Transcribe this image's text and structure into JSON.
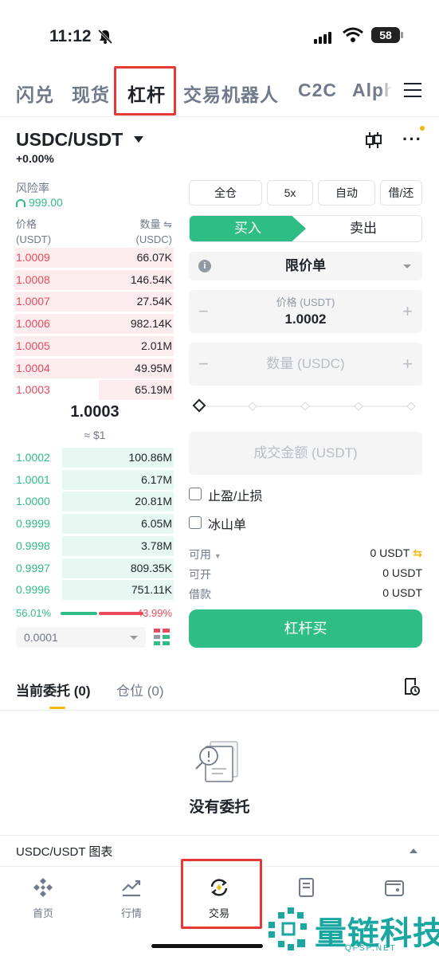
{
  "status_bar": {
    "time": "11:12",
    "battery": "58"
  },
  "top_tabs": [
    {
      "label": "闪兑"
    },
    {
      "label": "现货"
    },
    {
      "label": "杠杆",
      "active": true
    },
    {
      "label": "交易机器人"
    },
    {
      "label": "C2C"
    },
    {
      "label": "Alph"
    }
  ],
  "pair": {
    "name": "USDC/USDT",
    "change": "+0.00%"
  },
  "risk": {
    "label": "风险率",
    "value": "999.00"
  },
  "order_book": {
    "price_header": "价格",
    "price_unit": "(USDT)",
    "qty_header": "数量 ⇋",
    "qty_unit": "(USDC)",
    "asks": [
      {
        "price": "1.0009",
        "qty": "66.07K",
        "depth": 1.0
      },
      {
        "price": "1.0008",
        "qty": "146.54K",
        "depth": 1.0
      },
      {
        "price": "1.0007",
        "qty": "27.54K",
        "depth": 1.0
      },
      {
        "price": "1.0006",
        "qty": "982.14K",
        "depth": 1.0
      },
      {
        "price": "1.0005",
        "qty": "2.01M",
        "depth": 1.0
      },
      {
        "price": "1.0004",
        "qty": "49.95M",
        "depth": 1.0
      },
      {
        "price": "1.0003",
        "qty": "65.19M",
        "depth": 0.47
      }
    ],
    "mid_price": "1.0003",
    "mid_usd": "≈ $1",
    "bids": [
      {
        "price": "1.0002",
        "qty": "100.86M",
        "depth": 0.7
      },
      {
        "price": "1.0001",
        "qty": "6.17M",
        "depth": 0.7
      },
      {
        "price": "1.0000",
        "qty": "20.81M",
        "depth": 0.7
      },
      {
        "price": "0.9999",
        "qty": "6.05M",
        "depth": 0.7
      },
      {
        "price": "0.9998",
        "qty": "3.78M",
        "depth": 0.7
      },
      {
        "price": "0.9997",
        "qty": "809.35K",
        "depth": 0.7
      },
      {
        "price": "0.9996",
        "qty": "751.11K",
        "depth": 0.7
      }
    ],
    "buy_ratio": "56.01%",
    "sell_ratio": "43.99%",
    "precision": "0.0001"
  },
  "form": {
    "chips": [
      "全仓",
      "5x",
      "自动",
      "借/还"
    ],
    "buy_tab": "买入",
    "sell_tab": "卖出",
    "order_type": "限价单",
    "price_label": "价格 (USDT)",
    "price_value": "1.0002",
    "qty_placeholder": "数量 (USDC)",
    "amount_placeholder": "成交金额 (USDT)",
    "tp_sl": "止盈/止损",
    "iceberg": "冰山单",
    "available_label": "可用",
    "available_value": "0 USDT",
    "open_label": "可开",
    "open_value": "0 USDT",
    "borrow_label": "借款",
    "borrow_value": "0 USDT",
    "submit": "杠杆买",
    "minus": "−",
    "plus": "+"
  },
  "orders": {
    "tab_open": "当前委托 (0)",
    "tab_positions": "仓位 (0)",
    "empty": "没有委托"
  },
  "chart_bar": {
    "label": "USDC/USDT 图表"
  },
  "bottom_nav": [
    {
      "label": "首页",
      "icon": "home-icon"
    },
    {
      "label": "行情",
      "icon": "markets-icon"
    },
    {
      "label": "交易",
      "icon": "trade-icon",
      "active": true
    },
    {
      "label": "",
      "icon": "futures-icon"
    },
    {
      "label": "",
      "icon": "wallet-icon"
    }
  ],
  "watermark": {
    "text": "量链科技",
    "sub": "QFSP.NET"
  },
  "colors": {
    "green": "#2ebd85",
    "red": "#e84b5d",
    "yellow": "#f0b90b",
    "highlight": "#e53935"
  }
}
